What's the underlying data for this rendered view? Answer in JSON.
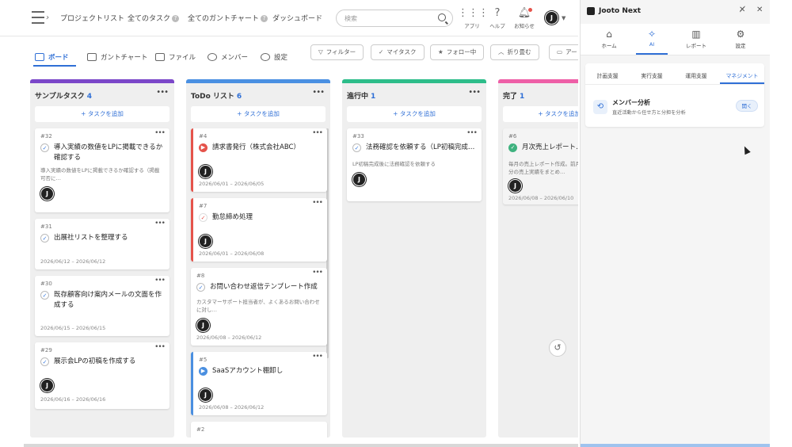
{
  "nav": {
    "links": [
      "プロジェクトリスト",
      "全てのタスク",
      "全てのガントチャート",
      "ダッシュボード"
    ],
    "search_placeholder": "検索",
    "apps_label": "アプリ",
    "help_label": "ヘルプ",
    "notify_label": "お知らせ",
    "help_glyph": "?"
  },
  "toolbar": {
    "tabs": [
      "ボード",
      "ガントチャート",
      "ファイル",
      "メンバー",
      "設定"
    ],
    "buttons": [
      "フィルター",
      "マイタスク",
      "フォロー中",
      "折り畳む",
      "アー"
    ]
  },
  "board": {
    "add_task_label": "+ タスクを追加",
    "columns": [
      {
        "name": "サンプルタスク",
        "count": "4",
        "color": "#7b47c9",
        "cards": [
          {
            "num": "#32",
            "title": "導入実績の数値をLPに掲載できるか確認する",
            "desc": "導入実績の数値をLPに掲載できるか確認する（掲載可否に…",
            "date": ""
          },
          {
            "num": "#31",
            "title": "出展社リストを整理する",
            "desc": "",
            "date": "2026/06/12 – 2026/06/12"
          },
          {
            "num": "#30",
            "title": "既存顧客向け案内メールの文面を作成する",
            "desc": "",
            "date": "2026/06/15 – 2026/06/15"
          },
          {
            "num": "#29",
            "title": "展示会LPの初稿を作成する",
            "desc": "",
            "date": "2026/06/16 – 2026/06/16"
          }
        ]
      },
      {
        "name": "ToDo リスト",
        "count": "6",
        "color": "#4a90e2",
        "cards": [
          {
            "num": "#4",
            "title": "請求書発行（株式会社ABC）",
            "desc": "",
            "date": "2026/06/01 – 2026/06/05"
          },
          {
            "num": "#7",
            "title": "勤怠締め処理",
            "desc": "",
            "date": "2026/06/01 – 2026/06/08"
          },
          {
            "num": "#8",
            "title": "お問い合わせ返信テンプレート作成",
            "desc": "カスタマーサポート担当者が、よくあるお問い合わせに対し…",
            "date": "2026/06/08 – 2026/06/12"
          },
          {
            "num": "#5",
            "title": "SaaSアカウント棚卸し",
            "desc": "",
            "date": "2026/06/08 – 2026/06/12"
          },
          {
            "num": "#2",
            "title": "",
            "desc": "",
            "date": ""
          }
        ]
      },
      {
        "name": "進行中",
        "count": "1",
        "color": "#2dbd8a",
        "cards": [
          {
            "num": "#33",
            "title": "法務確認を依頼する（LP初稿完成…",
            "desc": "LP初稿完成後に法務確認を依頼する",
            "date": ""
          }
        ]
      },
      {
        "name": "完了",
        "count": "1",
        "color": "#ee5fa7",
        "cards": [
          {
            "num": "#6",
            "title": "月次売上レポート…",
            "desc": "毎月の売上レポート作成。前月分の売上実績をまとめ…",
            "date": "2026/06/08 – 2026/06/10"
          }
        ]
      }
    ]
  },
  "panel": {
    "title": "Jooto Next",
    "tabs": [
      "ホーム",
      "AI",
      "レポート",
      "設定"
    ],
    "sub_tabs": [
      "計画支援",
      "実行支援",
      "運用支援",
      "マネジメント"
    ],
    "feature_title": "メンバー分析",
    "feature_desc": "直近活動から任せ方と分担を分析",
    "open_label": "開く"
  }
}
